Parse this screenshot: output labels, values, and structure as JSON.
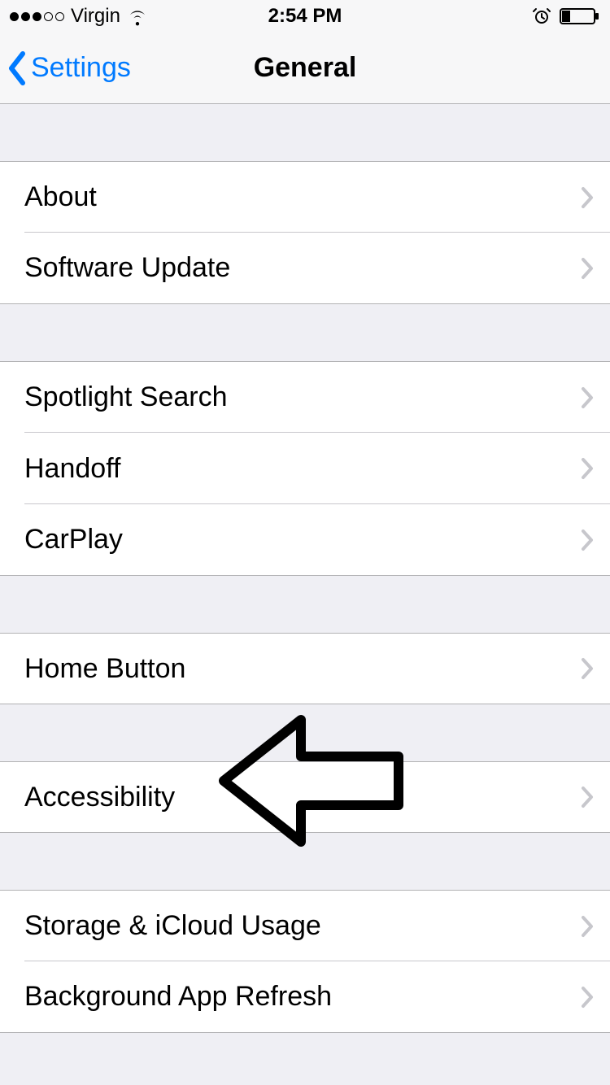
{
  "status_bar": {
    "carrier": "Virgin",
    "time": "2:54 PM"
  },
  "nav": {
    "back_label": "Settings",
    "title": "General"
  },
  "groups": [
    {
      "items": [
        {
          "label": "About"
        },
        {
          "label": "Software Update"
        }
      ]
    },
    {
      "items": [
        {
          "label": "Spotlight Search"
        },
        {
          "label": "Handoff"
        },
        {
          "label": "CarPlay"
        }
      ]
    },
    {
      "items": [
        {
          "label": "Home Button"
        }
      ]
    },
    {
      "items": [
        {
          "label": "Accessibility"
        }
      ]
    },
    {
      "items": [
        {
          "label": "Storage & iCloud Usage"
        },
        {
          "label": "Background App Refresh"
        }
      ]
    }
  ]
}
